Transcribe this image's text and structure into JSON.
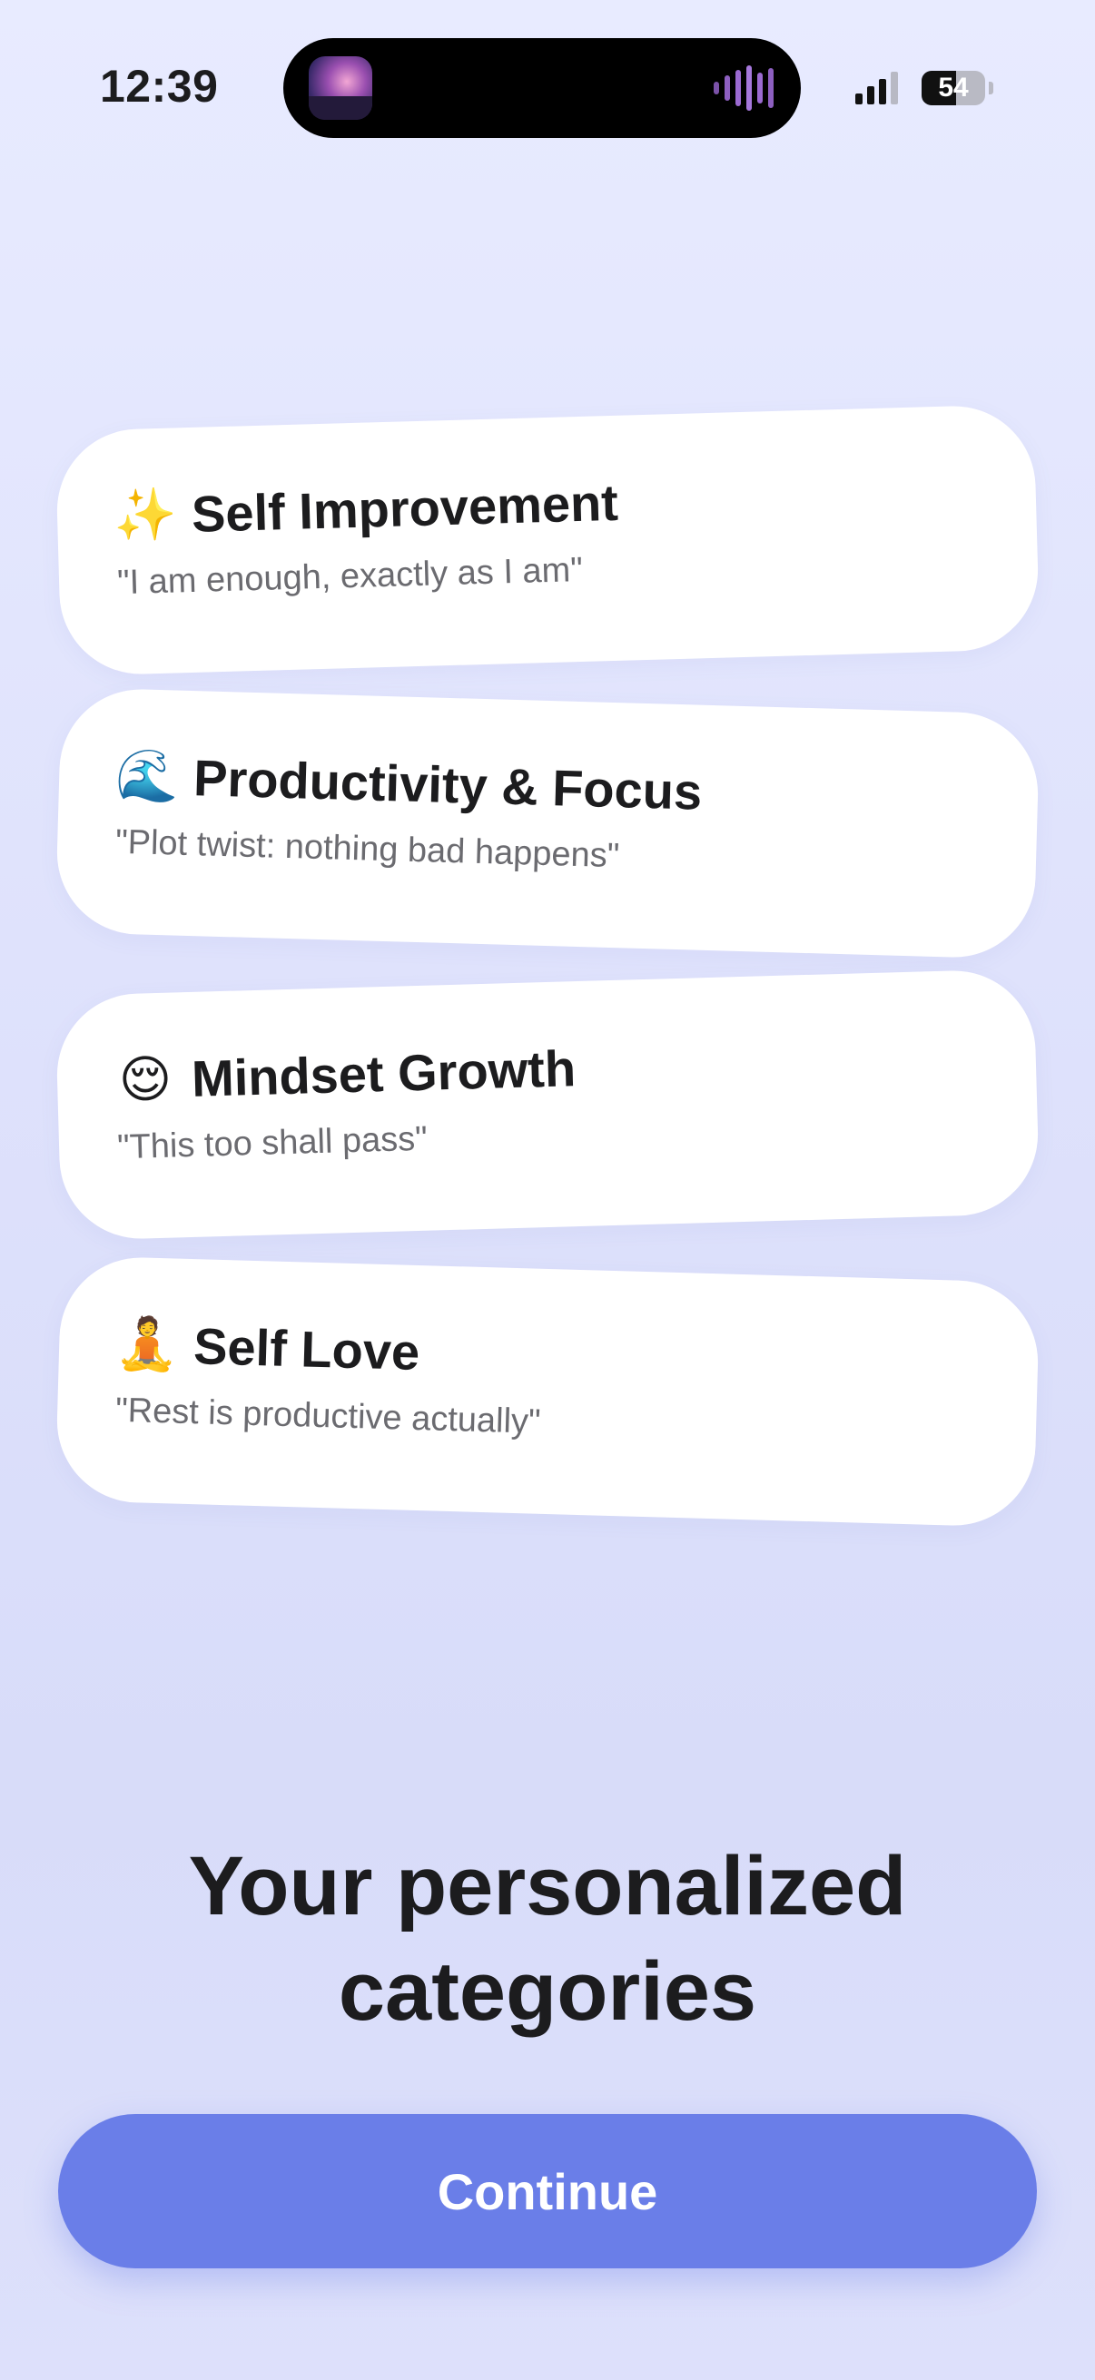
{
  "status_bar": {
    "time": "12:39",
    "battery": "54"
  },
  "categories": [
    {
      "emoji": "✨",
      "icon": "sparkles-icon",
      "title": "Self Improvement",
      "quote": "\"I am enough, exactly as I am\""
    },
    {
      "emoji": "🌊",
      "icon": "wave-icon",
      "title": "Productivity & Focus",
      "quote": "\"Plot twist: nothing bad happens\""
    },
    {
      "emoji": "😌",
      "icon": "relieved-face-icon",
      "title": "Mindset Growth",
      "quote": "\"This too shall pass\""
    },
    {
      "emoji": "🧘",
      "icon": "meditation-icon",
      "title": "Self Love",
      "quote": "\"Rest is productive actually\""
    }
  ],
  "heading": {
    "line1": "Your personalized",
    "line2": "categories"
  },
  "continue_label": "Continue",
  "colors": {
    "accent": "#6a7ee8",
    "background": "#e2e5fd",
    "card": "#ffffff"
  }
}
